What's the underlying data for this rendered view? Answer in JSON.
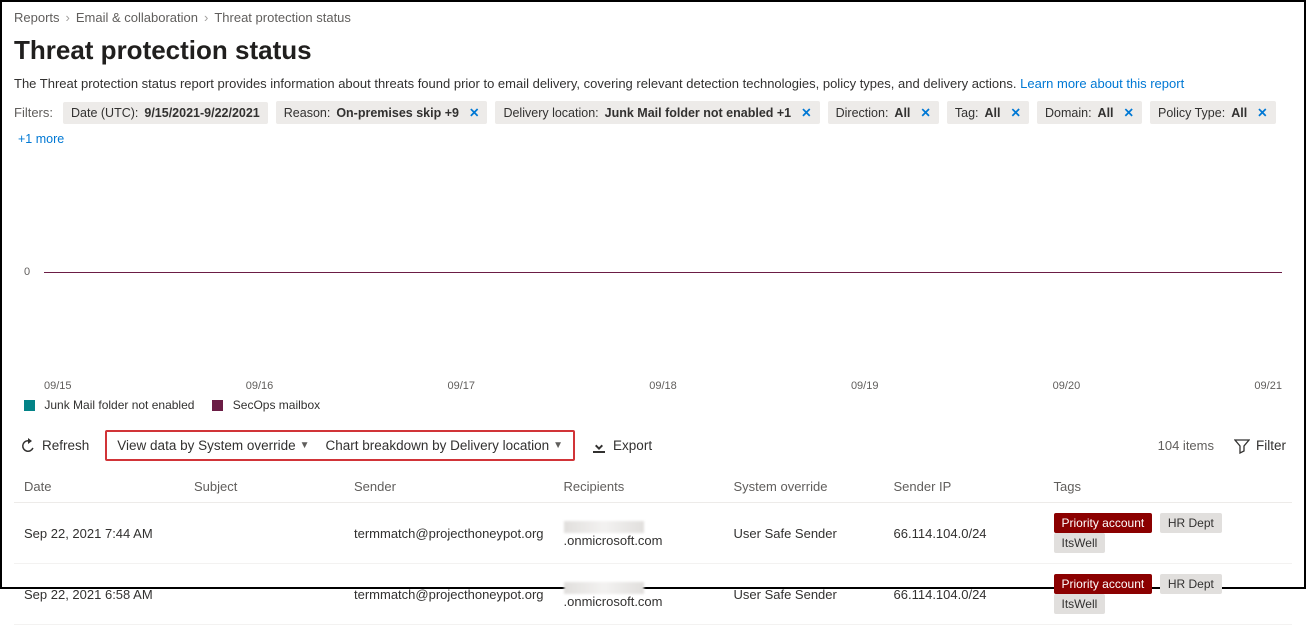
{
  "breadcrumb": {
    "items": [
      "Reports",
      "Email & collaboration",
      "Threat protection status"
    ]
  },
  "title": "Threat protection status",
  "description": "The Threat protection status report provides information about threats found prior to email delivery, covering relevant detection technologies, policy types, and delivery actions.",
  "learn_more_label": "Learn more about this report",
  "filters": {
    "label": "Filters:",
    "items": [
      {
        "key": "Date (UTC):",
        "value": "9/15/2021-9/22/2021",
        "closable": false
      },
      {
        "key": "Reason:",
        "value": "On-premises skip +9",
        "closable": true
      },
      {
        "key": "Delivery location:",
        "value": "Junk Mail folder not enabled +1",
        "closable": true
      },
      {
        "key": "Direction:",
        "value": "All",
        "closable": true
      },
      {
        "key": "Tag:",
        "value": "All",
        "closable": true
      },
      {
        "key": "Domain:",
        "value": "All",
        "closable": true
      },
      {
        "key": "Policy Type:",
        "value": "All",
        "closable": true
      }
    ],
    "more_label": "+1 more"
  },
  "chart_data": {
    "type": "line",
    "title": "",
    "xlabel": "",
    "ylabel": "",
    "categories": [
      "09/15",
      "09/16",
      "09/17",
      "09/18",
      "09/19",
      "09/20",
      "09/21"
    ],
    "series": [
      {
        "name": "Junk Mail folder not enabled",
        "color": "#038387",
        "values": [
          0,
          0,
          0,
          0,
          0,
          0,
          0
        ]
      },
      {
        "name": "SecOps mailbox",
        "color": "#6b1d45",
        "values": [
          0,
          0,
          0,
          0,
          0,
          0,
          0
        ]
      }
    ],
    "ylim": [
      0,
      0
    ],
    "yticks": [
      0
    ]
  },
  "toolbar": {
    "refresh_label": "Refresh",
    "view_data_label": "View data by System override",
    "chart_breakdown_label": "Chart breakdown by Delivery location",
    "export_label": "Export",
    "items_count_label": "104 items",
    "filter_label": "Filter"
  },
  "table": {
    "columns": [
      "Date",
      "Subject",
      "Sender",
      "Recipients",
      "System override",
      "Sender IP",
      "Tags"
    ],
    "rows": [
      {
        "date": "Sep 22, 2021 7:44 AM",
        "subject": "",
        "sender": "termmatch@projecthoneypot.org",
        "recipient_prefix_redacted": true,
        "recipient_suffix": ".onmicrosoft.com",
        "system_override": "User Safe Sender",
        "sender_ip": "66.114.104.0/24",
        "tags": [
          {
            "text": "Priority account",
            "type": "priority"
          },
          {
            "text": "HR Dept",
            "type": "grey"
          },
          {
            "text": "ItsWell",
            "type": "grey"
          }
        ]
      },
      {
        "date": "Sep 22, 2021 6:58 AM",
        "subject": "",
        "sender": "termmatch@projecthoneypot.org",
        "recipient_prefix_redacted": true,
        "recipient_suffix": ".onmicrosoft.com",
        "system_override": "User Safe Sender",
        "sender_ip": "66.114.104.0/24",
        "tags": [
          {
            "text": "Priority account",
            "type": "priority"
          },
          {
            "text": "HR Dept",
            "type": "grey"
          },
          {
            "text": "ItsWell",
            "type": "grey"
          }
        ]
      }
    ]
  }
}
